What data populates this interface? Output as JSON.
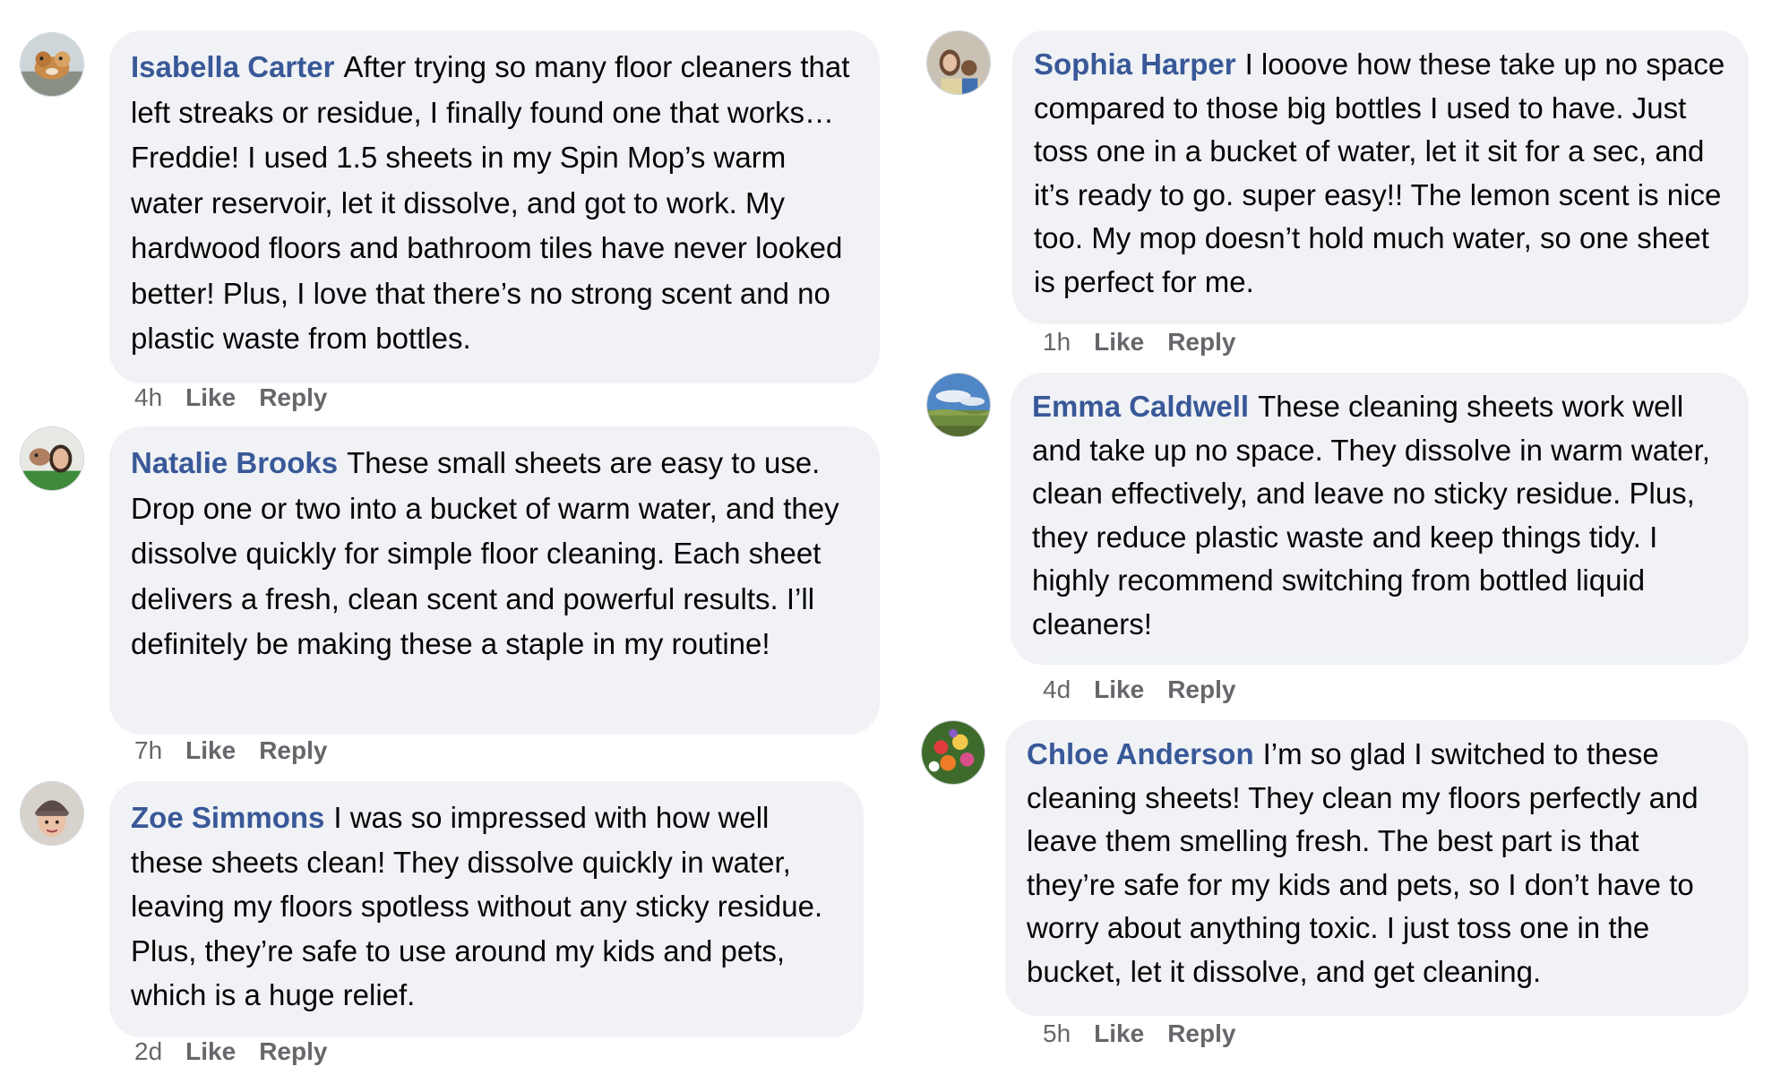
{
  "comments": [
    {
      "name": "Isabella Carter",
      "text": "After trying so many floor cleaners that left streaks or residue, I finally found one that works…Freddie! I used 1.5 sheets in my Spin Mop’s warm water reservoir, let it dissolve, and got to work. My hardwood floors and bathroom tiles have never looked better! Plus, I love that there’s no strong scent and no plastic waste from bottles.",
      "time": "4h",
      "like": "Like",
      "reply": "Reply",
      "avatar_icon": "dog-photo-avatar"
    },
    {
      "name": "Natalie Brooks",
      "text": "These small sheets are easy to use. Drop one or two into a bucket of warm water, and they dissolve quickly for simple floor cleaning. Each sheet delivers a fresh, clean scent and powerful results. I’ll definitely be making these a staple in my routine!",
      "time": "7h",
      "like": "Like",
      "reply": "Reply",
      "avatar_icon": "woman-with-dog-avatar"
    },
    {
      "name": "Zoe Simmons",
      "text": "I was so impressed with how well these sheets clean! They dissolve quickly in water, leaving my floors spotless without any sticky residue. Plus, they’re safe to use around my kids and pets, which is a huge relief.",
      "time": "2d",
      "like": "Like",
      "reply": "Reply",
      "avatar_icon": "woman-beanie-avatar"
    },
    {
      "name": "Sophia Harper",
      "text": "I looove how these take up no space compared to those big bottles I used to have. Just toss one in a bucket of water, let it sit for a sec, and it’s ready to go. super easy!! The lemon scent is nice too. My mop doesn’t hold much water, so one sheet is perfect for me.",
      "time": "1h",
      "like": "Like",
      "reply": "Reply",
      "avatar_icon": "family-photo-avatar"
    },
    {
      "name": "Emma Caldwell",
      "text": "These cleaning sheets work well and take up no space. They dissolve in warm water, clean effectively, and leave no sticky residue. Plus, they reduce plastic waste and keep things tidy. I highly recommend switching from bottled liquid cleaners!",
      "time": "4d",
      "like": "Like",
      "reply": "Reply",
      "avatar_icon": "landscape-avatar"
    },
    {
      "name": "Chloe Anderson",
      "text": "I’m so glad I switched to these cleaning sheets! They clean my floors perfectly and leave them smelling fresh. The best part is that they’re safe for my kids and pets, so I don’t have to worry about anything toxic. I just toss one in the bucket, let it dissolve, and get cleaning.",
      "time": "5h",
      "like": "Like",
      "reply": "Reply",
      "avatar_icon": "flowers-avatar"
    }
  ],
  "colors": {
    "name": "#385898",
    "bubble": "#f0f2f5",
    "text": "#050505",
    "meta": "#65676b"
  }
}
